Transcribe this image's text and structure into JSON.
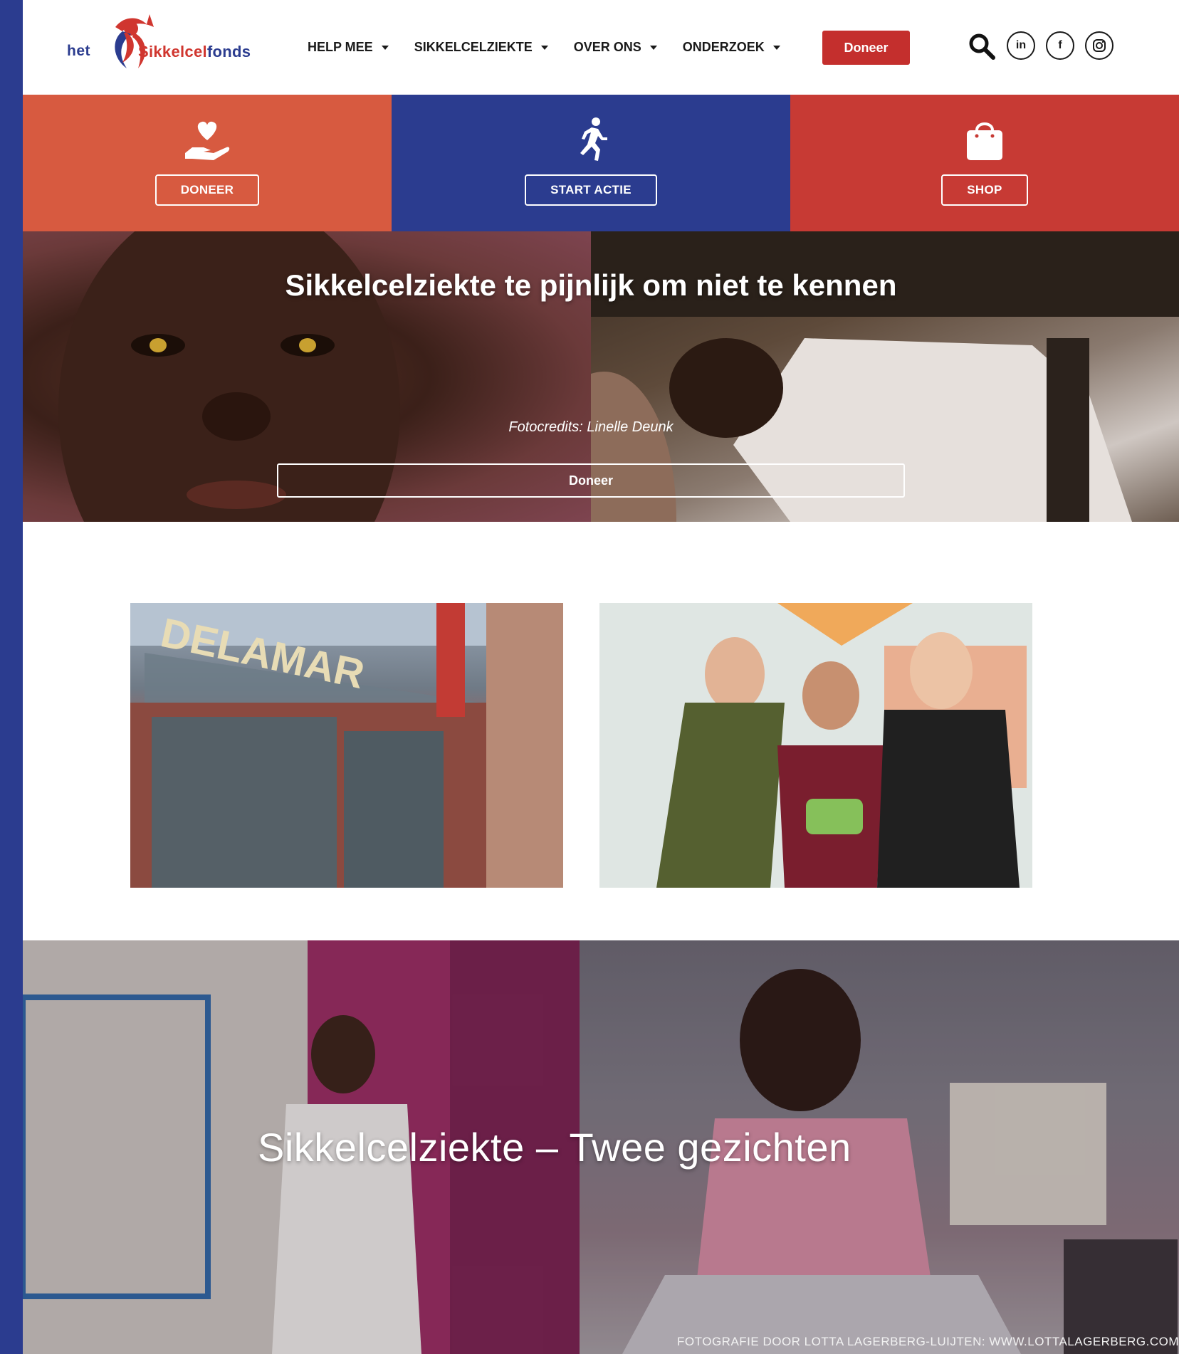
{
  "brand": {
    "prefix": "het",
    "name_part1": "Sikkelcel",
    "name_part2": "fonds",
    "color_red": "#d0362f",
    "color_blue": "#2b3c8f"
  },
  "nav": {
    "items": [
      {
        "label": "HELP MEE"
      },
      {
        "label": "SIKKELCELZIEKTE"
      },
      {
        "label": "OVER ONS"
      },
      {
        "label": "ONDERZOEK"
      }
    ],
    "donate_label": "Doneer",
    "social": {
      "linkedin": "in",
      "facebook": "f",
      "instagram": "instagram-icon"
    }
  },
  "tiles": [
    {
      "icon": "heart-hand-icon",
      "label": "DONEER",
      "color": "#d75a40"
    },
    {
      "icon": "running-person-icon",
      "label": "START ACTIE",
      "color": "#2b3c8f"
    },
    {
      "icon": "shopping-bag-icon",
      "label": "SHOP",
      "color": "#c73a34"
    }
  ],
  "hero": {
    "title": "Sikkelcelziekte te pijnlijk om niet te kennen",
    "credit": "Fotocredits: Linelle Deunk",
    "button_label": "Doneer"
  },
  "banner": {
    "title": "Sikkelcelziekte – Twee gezichten",
    "credit": "FOTOGRAFIE DOOR LOTTA LAGERBERG-LUIJTEN: WWW.LOTTALAGERBERG.COM"
  }
}
